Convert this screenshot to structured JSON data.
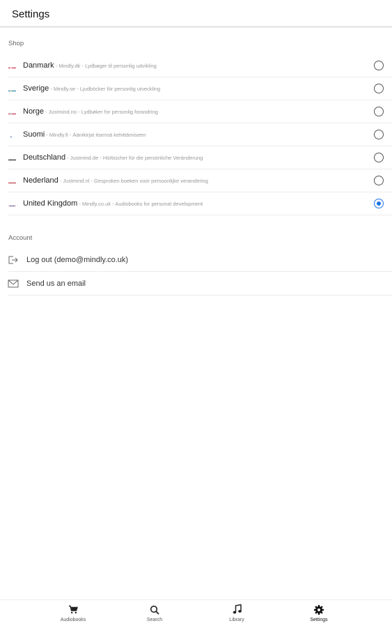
{
  "header": {
    "title": "Settings"
  },
  "shop": {
    "section_label": "Shop",
    "items": [
      {
        "name": "Danmark",
        "subtitle": " - Mindly.dk - Lydbøger til personlig udvikling",
        "flag": "dk-flag-icon",
        "selected": false
      },
      {
        "name": "Sverige",
        "subtitle": " - Mindly.se - Ljudböcker för personlig utveckling",
        "flag": "se-flag-icon",
        "selected": false
      },
      {
        "name": "Norge",
        "subtitle": " - Justmind.no - Lydbøker for personlig forandring",
        "flag": "no-flag-icon",
        "selected": false
      },
      {
        "name": "Suomi",
        "subtitle": " - Mindly.fi - Äänikirjat itsensä kehittämiseen",
        "flag": "fi-flag-icon",
        "selected": false
      },
      {
        "name": "Deutschland",
        "subtitle": " - Justmind.de - Hörbücher für die persönliche Veränderung",
        "flag": "de-flag-icon",
        "selected": false
      },
      {
        "name": "Nederland",
        "subtitle": " - Justmind.nl - Gesproken boeken voor persoonlijke verandering",
        "flag": "nl-flag-icon",
        "selected": false
      },
      {
        "name": "United Kingdom",
        "subtitle": " - Mindly.co.uk - Audiobooks for personal development",
        "flag": "uk-flag-icon",
        "selected": true
      }
    ]
  },
  "account": {
    "section_label": "Account",
    "logout_label": "Log out (demo@mindly.co.uk)",
    "email_label": "Send us an email"
  },
  "colors": {
    "accent": "#1a73e8"
  },
  "nav": {
    "items": [
      {
        "label": "Audiobooks",
        "icon": "cart-icon"
      },
      {
        "label": "Search",
        "icon": "search-icon"
      },
      {
        "label": "Library",
        "icon": "music-note-icon"
      },
      {
        "label": "Settings",
        "icon": "gear-icon",
        "active": true
      }
    ]
  }
}
